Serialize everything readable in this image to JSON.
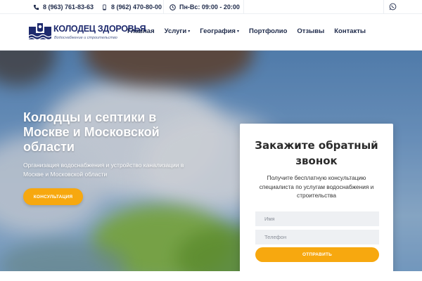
{
  "topbar": {
    "phone1": "8 (963) 761-83-63",
    "phone2": "8 (962) 470-80-00",
    "hours": "Пн-Вс: 09:00 - 20:00",
    "icons": [
      "phone-icon",
      "mobile-icon",
      "clock-icon",
      "whatsapp-icon"
    ]
  },
  "logo": {
    "title": "КОЛОДЕЦ ЗДОРОВЬЯ",
    "subtitle": "Водоснабжение и строительство"
  },
  "nav": {
    "items": [
      {
        "label": "Главная"
      },
      {
        "label": "Услуги",
        "dropdown": true
      },
      {
        "label": "География",
        "dropdown": true
      },
      {
        "label": "Портфолио"
      },
      {
        "label": "Отзывы"
      },
      {
        "label": "Контакты"
      }
    ],
    "caret": "▾"
  },
  "hero": {
    "title": "Колодцы и септики в Москве и Московской области",
    "subtitle": "Организация водоснабжения и устройство канализации в Москве и Московской области",
    "button": "КОНСУЛЬТАЦИЯ"
  },
  "form": {
    "title": "Закажите обратный звонок",
    "description": "Получите бесплатную консультацию специалиста по услугам водоснабжения и строительства",
    "name_placeholder": "Имя",
    "phone_placeholder": "Телефон",
    "submit": "ОТПРАВИТЬ"
  },
  "colors": {
    "accent": "#f7a80f",
    "brand": "#1e2a6e",
    "text_dark": "#1e2a4a"
  }
}
